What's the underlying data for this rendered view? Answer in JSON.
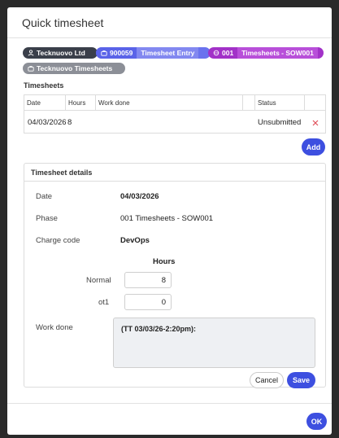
{
  "dialog": {
    "title": "Quick timesheet"
  },
  "chips": {
    "company": "Tecknuovo Ltd",
    "entry_code": "900059",
    "entry_label": "Timesheet Entry",
    "phase_code": "001",
    "phase_label": "Timesheets - SOW001",
    "group": "Tecknuovo Timesheets"
  },
  "timesheets": {
    "label": "Timesheets",
    "columns": {
      "date": "Date",
      "hours": "Hours",
      "work_done": "Work done",
      "status": "Status"
    },
    "rows": [
      {
        "date": "04/03/2026",
        "hours": "8",
        "work_done": "",
        "status": "Unsubmitted"
      }
    ],
    "add_label": "Add"
  },
  "details": {
    "header": "Timesheet details",
    "date_label": "Date",
    "date_value": "04/03/2026",
    "phase_label": "Phase",
    "phase_value": "001 Timesheets - SOW001",
    "charge_label": "Charge code",
    "charge_value": "DevOps",
    "hours_header": "Hours",
    "normal_label": "Normal",
    "normal_value": "8",
    "ot1_label": "ot1",
    "ot1_value": "0",
    "work_label": "Work done",
    "work_value": "(TT 03/03/26-2:20pm):",
    "cancel_label": "Cancel",
    "save_label": "Save"
  },
  "footer": {
    "ok_label": "OK"
  },
  "colors": {
    "company_chip": "#3a3f4a",
    "entry_chip": "#5a63e8",
    "phase_chip": "#a232c8",
    "group_chip": "#8c8f97",
    "primary_button": "#3d4fe0",
    "delete_icon": "#e0505a"
  }
}
